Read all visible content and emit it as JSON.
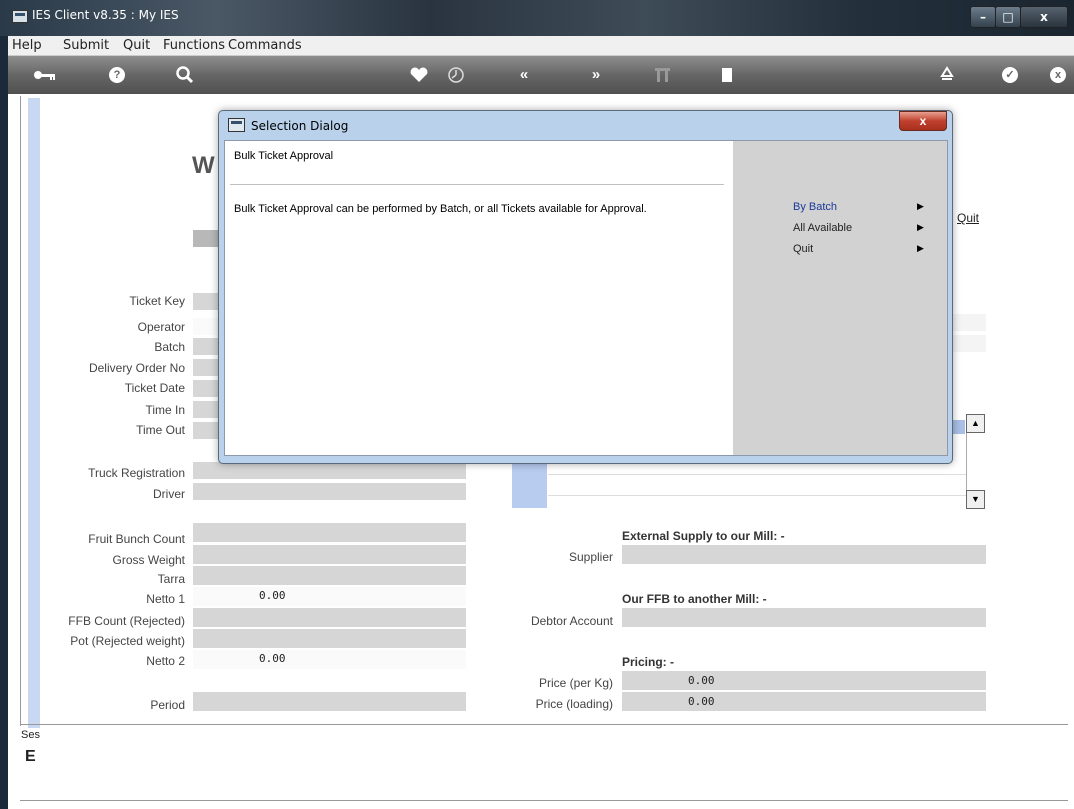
{
  "window": {
    "title": "IES Client v8.35 : My IES",
    "min": "–",
    "max": "□",
    "close": "x"
  },
  "menu": [
    "Help",
    "Submit",
    "Quit",
    "Functions",
    "Commands"
  ],
  "toolbar_icons": [
    "key-icon",
    "help-icon",
    "search-icon",
    "heart-icon",
    "clock-icon",
    "rewind-icon",
    "fast-forward-icon",
    "tools-icon",
    "document-icon",
    "recycle-icon",
    "check-icon",
    "close-icon"
  ],
  "page": {
    "title_fragment": "W",
    "quit_link": "Quit",
    "footer_frag": "Ses",
    "footer_icon": "E"
  },
  "form_left": {
    "ticket_key": "Ticket Key",
    "operator": "Operator",
    "batch": "Batch",
    "delivery_order_no": "Delivery Order No",
    "ticket_date": "Ticket Date",
    "time_in": "Time In",
    "time_out": "Time Out",
    "truck_registration": "Truck Registration",
    "driver": "Driver",
    "fruit_bunch_count": "Fruit Bunch Count",
    "gross_weight": "Gross Weight",
    "tarra": "Tarra",
    "netto_1": "Netto 1",
    "netto_1_value": "0.00",
    "ffb_count_rejected": "FFB Count (Rejected)",
    "pot_rejected_weight": "Pot (Rejected weight)",
    "netto_2": "Netto 2",
    "netto_2_value": "0.00",
    "period": "Period"
  },
  "form_right": {
    "external_supply_heading": "External Supply to our Mill: -",
    "supplier": "Supplier",
    "our_ffb_heading": "Our FFB to another Mill: -",
    "debtor_account": "Debtor Account",
    "pricing_heading": "Pricing: -",
    "price_per_kg": "Price (per Kg)",
    "price_per_kg_value": "0.00",
    "price_loading": "Price (loading)",
    "price_loading_value": "0.00"
  },
  "dialog": {
    "title": "Selection Dialog",
    "close": "x",
    "heading": "Bulk Ticket Approval",
    "description": "Bulk Ticket Approval can be performed by Batch, or all Tickets available for Approval.",
    "options": [
      {
        "label": "By Batch",
        "arrow": "▶"
      },
      {
        "label": "All Available",
        "arrow": "▶"
      },
      {
        "label": "Quit",
        "arrow": "▶"
      }
    ]
  },
  "scroll": {
    "up": "▲",
    "down": "▼"
  }
}
